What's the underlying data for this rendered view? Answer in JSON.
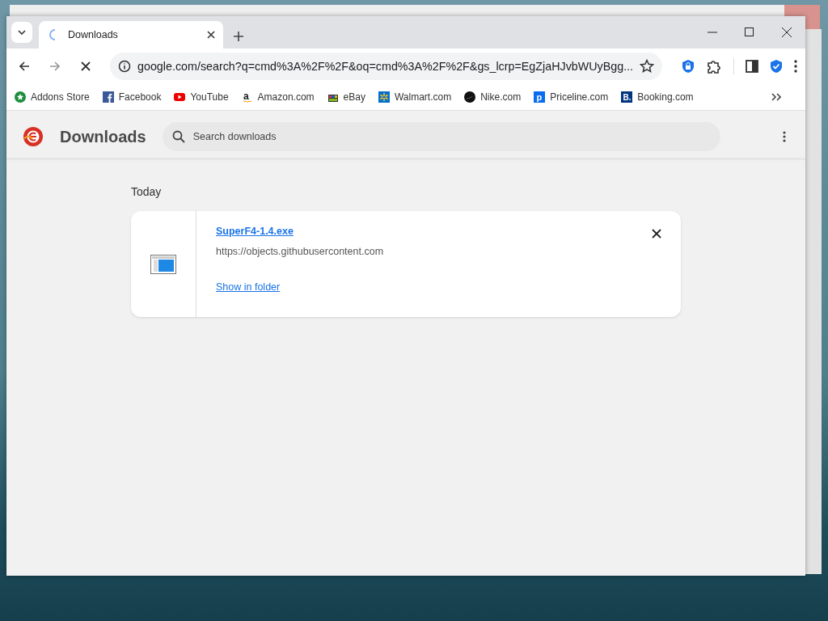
{
  "tab": {
    "title": "Downloads",
    "selected": true
  },
  "toolbar": {
    "url": "google.com/search?q=cmd%3A%2F%2F&oq=cmd%3A%2F%2F&gs_lcrp=EgZjaHJvbWUyBgg..."
  },
  "bookmarks": [
    {
      "label": "Addons Store",
      "kind": "addons"
    },
    {
      "label": "Facebook",
      "kind": "facebook"
    },
    {
      "label": "YouTube",
      "kind": "youtube"
    },
    {
      "label": "Amazon.com",
      "kind": "amazon",
      "glyph": "a"
    },
    {
      "label": "eBay",
      "kind": "ebay"
    },
    {
      "label": "Walmart.com",
      "kind": "walmart"
    },
    {
      "label": "Nike.com",
      "kind": "nike"
    },
    {
      "label": "Priceline.com",
      "kind": "priceline",
      "glyph": "p"
    },
    {
      "label": "Booking.com",
      "kind": "booking",
      "glyph": "B."
    }
  ],
  "page": {
    "title": "Downloads",
    "search": {
      "placeholder": "Search downloads"
    },
    "section": "Today",
    "download": {
      "file": "SuperF4-1.4.exe",
      "source": "https://objects.githubusercontent.com",
      "action": "Show in folder"
    }
  }
}
